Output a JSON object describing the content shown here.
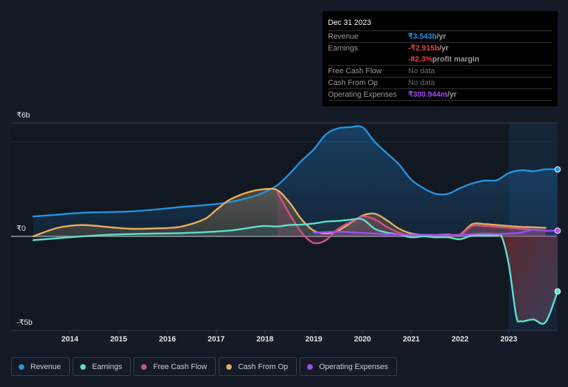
{
  "tooltip": {
    "date": "Dec 31 2023",
    "rows": [
      {
        "label": "Revenue",
        "value": "₹3.543b",
        "unit": " /yr",
        "color": "#2394df"
      },
      {
        "label": "Earnings",
        "value": "-₹2.915b",
        "unit": " /yr",
        "color": "#e64545"
      },
      {
        "label": "",
        "value": "-82.3%",
        "unit": " profit margin",
        "color": "#e64545"
      },
      {
        "label": "Free Cash Flow",
        "value": "No data",
        "unit": "",
        "color": "#6b6b6b"
      },
      {
        "label": "Cash From Op",
        "value": "No data",
        "unit": "",
        "color": "#6b6b6b"
      },
      {
        "label": "Operating Expenses",
        "value": "₹300.944m",
        "unit": " /yr",
        "color": "#a24bf0"
      }
    ]
  },
  "legend": [
    {
      "label": "Revenue",
      "color": "#2394df"
    },
    {
      "label": "Earnings",
      "color": "#5ee0cc"
    },
    {
      "label": "Free Cash Flow",
      "color": "#d0508a"
    },
    {
      "label": "Cash From Op",
      "color": "#e9ae5c"
    },
    {
      "label": "Operating Expenses",
      "color": "#a24bf0"
    }
  ],
  "chart_data": {
    "type": "line",
    "title": "",
    "xlabel": "",
    "ylabel": "",
    "y_unit": "₹ billions",
    "ylim": [
      -5,
      6
    ],
    "y_tick_labels": [
      "₹6b",
      "₹0",
      "-₹5b"
    ],
    "y_ticks": [
      6,
      0,
      -5
    ],
    "x_tick_labels": [
      "2014",
      "2015",
      "2016",
      "2017",
      "2018",
      "2019",
      "2020",
      "2021",
      "2022",
      "2023"
    ],
    "x_ticks": [
      2014,
      2015,
      2016,
      2017,
      2018,
      2019,
      2020,
      2021,
      2022,
      2023
    ],
    "xlim": [
      2013.25,
      2024.0
    ],
    "highlight_start": 2023.0,
    "series": [
      {
        "name": "Revenue",
        "color": "#2394df",
        "x": [
          2013.25,
          2013.75,
          2014.25,
          2014.75,
          2015.25,
          2015.75,
          2016.25,
          2016.75,
          2017.25,
          2017.75,
          2018.0,
          2018.25,
          2018.5,
          2018.75,
          2019.0,
          2019.25,
          2019.5,
          2019.75,
          2020.0,
          2020.25,
          2020.5,
          2020.75,
          2021.0,
          2021.25,
          2021.5,
          2021.75,
          2022.0,
          2022.25,
          2022.5,
          2022.75,
          2023.0,
          2023.25,
          2023.5,
          2023.75,
          2024.0
        ],
        "values": [
          1.05,
          1.15,
          1.25,
          1.28,
          1.32,
          1.42,
          1.55,
          1.65,
          1.8,
          2.1,
          2.35,
          2.7,
          3.3,
          4.0,
          4.6,
          5.4,
          5.72,
          5.78,
          5.78,
          5.0,
          4.4,
          3.8,
          3.0,
          2.55,
          2.25,
          2.25,
          2.55,
          2.8,
          2.95,
          2.97,
          3.35,
          3.5,
          3.45,
          3.55,
          3.543
        ]
      },
      {
        "name": "Earnings",
        "color": "#5ee0cc",
        "x": [
          2013.25,
          2013.75,
          2014.25,
          2014.75,
          2015.25,
          2015.75,
          2016.25,
          2016.75,
          2017.25,
          2017.5,
          2017.75,
          2018.0,
          2018.25,
          2018.5,
          2018.75,
          2019.0,
          2019.25,
          2019.5,
          2019.75,
          2020.0,
          2020.25,
          2020.5,
          2020.75,
          2021.0,
          2021.25,
          2021.5,
          2021.75,
          2022.0,
          2022.25,
          2022.5,
          2022.75,
          2022.85,
          2023.0,
          2023.15,
          2023.25,
          2023.5,
          2023.75,
          2024.0
        ],
        "values": [
          -0.2,
          -0.1,
          0.0,
          0.08,
          0.12,
          0.15,
          0.17,
          0.22,
          0.3,
          0.38,
          0.48,
          0.55,
          0.52,
          0.6,
          0.62,
          0.68,
          0.78,
          0.82,
          0.88,
          0.9,
          0.4,
          0.2,
          0.1,
          -0.05,
          0.0,
          -0.05,
          -0.05,
          -0.15,
          0.05,
          0.05,
          0.05,
          0.0,
          -1.5,
          -4.2,
          -4.5,
          -4.4,
          -4.55,
          -2.915
        ]
      },
      {
        "name": "Free Cash Flow",
        "color": "#d0508a",
        "x": [
          2018.25,
          2018.5,
          2018.75,
          2019.0,
          2019.25,
          2019.5,
          2019.75,
          2020.0,
          2020.25,
          2020.5,
          2020.75,
          2021.0,
          2021.25,
          2021.5,
          2021.75,
          2022.0,
          2022.25,
          2022.5,
          2022.75,
          2023.0,
          2023.25,
          2023.5,
          2023.75
        ],
        "values": [
          2.35,
          1.2,
          0.2,
          -0.35,
          -0.2,
          0.4,
          0.75,
          1.05,
          0.9,
          0.5,
          0.2,
          0.05,
          0.05,
          0.05,
          0.05,
          0.08,
          0.55,
          0.55,
          0.5,
          0.45,
          0.4,
          0.35,
          0.3
        ]
      },
      {
        "name": "Cash From Op",
        "color": "#e9ae5c",
        "x": [
          2013.25,
          2013.75,
          2014.25,
          2014.75,
          2015.25,
          2015.75,
          2016.25,
          2016.75,
          2017.0,
          2017.25,
          2017.5,
          2017.75,
          2018.0,
          2018.25,
          2018.5,
          2018.75,
          2019.0,
          2019.25,
          2019.5,
          2019.75,
          2020.0,
          2020.25,
          2020.5,
          2020.75,
          2021.0,
          2021.25,
          2021.5,
          2021.75,
          2022.0,
          2022.25,
          2022.5,
          2022.75,
          2023.0,
          2023.25,
          2023.5,
          2023.75
        ],
        "values": [
          0.0,
          0.45,
          0.6,
          0.5,
          0.4,
          0.42,
          0.5,
          0.9,
          1.4,
          1.9,
          2.2,
          2.4,
          2.5,
          2.45,
          1.8,
          0.9,
          0.3,
          0.15,
          0.3,
          0.7,
          1.1,
          1.2,
          0.85,
          0.4,
          0.15,
          0.08,
          0.08,
          0.1,
          0.1,
          0.65,
          0.65,
          0.6,
          0.55,
          0.5,
          0.48,
          0.45
        ]
      },
      {
        "name": "Operating Expenses",
        "color": "#a24bf0",
        "x": [
          2019.0,
          2019.25,
          2019.5,
          2019.75,
          2020.0,
          2020.25,
          2020.5,
          2020.75,
          2021.0,
          2021.25,
          2021.5,
          2021.75,
          2022.0,
          2022.25,
          2022.5,
          2022.75,
          2023.0,
          2023.25,
          2023.5,
          2023.75,
          2024.0
        ],
        "values": [
          0.2,
          0.22,
          0.25,
          0.22,
          0.18,
          0.15,
          0.12,
          0.1,
          0.08,
          0.08,
          0.08,
          0.08,
          0.08,
          0.12,
          0.15,
          0.13,
          0.15,
          0.2,
          0.35,
          0.3,
          0.301
        ]
      }
    ]
  }
}
